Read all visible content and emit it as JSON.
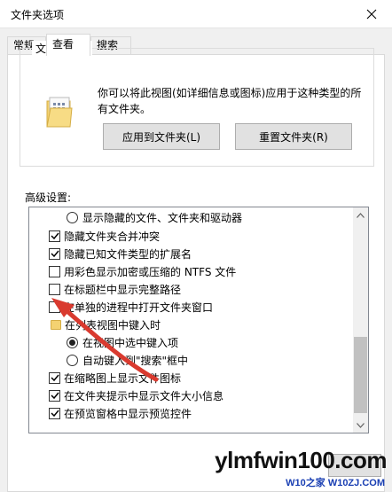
{
  "window": {
    "title": "文件夹选项"
  },
  "tabs": [
    {
      "label": "常规"
    },
    {
      "label": "查看"
    },
    {
      "label": "搜索"
    }
  ],
  "folder_view": {
    "group_title": "文件夹视图",
    "description": "你可以将此视图(如详细信息或图标)应用于这种类型的所有文件夹。",
    "apply_button": "应用到文件夹(L)",
    "reset_button": "重置文件夹(R)"
  },
  "advanced": {
    "label": "高级设置:",
    "items": [
      {
        "type": "radio",
        "checked": false,
        "indent": true,
        "label": "显示隐藏的文件、文件夹和驱动器"
      },
      {
        "type": "checkbox",
        "checked": true,
        "label": "隐藏文件夹合并冲突"
      },
      {
        "type": "checkbox",
        "checked": true,
        "label": "隐藏已知文件类型的扩展名"
      },
      {
        "type": "checkbox",
        "checked": false,
        "label": "用彩色显示加密或压缩的 NTFS 文件"
      },
      {
        "type": "checkbox",
        "checked": false,
        "label": "在标题栏中显示完整路径"
      },
      {
        "type": "checkbox",
        "checked": false,
        "label": "在单独的进程中打开文件夹窗口"
      },
      {
        "type": "folder",
        "label": "在列表视图中键入时"
      },
      {
        "type": "radio",
        "checked": true,
        "indent": true,
        "label": "在视图中选中键入项"
      },
      {
        "type": "radio",
        "checked": false,
        "indent": true,
        "label": "自动键入到\"搜索\"框中"
      },
      {
        "type": "checkbox",
        "checked": true,
        "label": "在缩略图上显示文件图标"
      },
      {
        "type": "checkbox",
        "checked": true,
        "label": "在文件夹提示中显示文件大小信息"
      },
      {
        "type": "checkbox",
        "checked": true,
        "label": "在预览窗格中显示预览控件"
      }
    ]
  },
  "watermark": {
    "main": "ylmfwin100.com",
    "sub": "W10之家 W10ZJ.COM"
  },
  "colors": {
    "annotation_arrow": "#d93a2f",
    "scroll_thumb": "#c1c1c1",
    "folder": "#f4d271"
  }
}
